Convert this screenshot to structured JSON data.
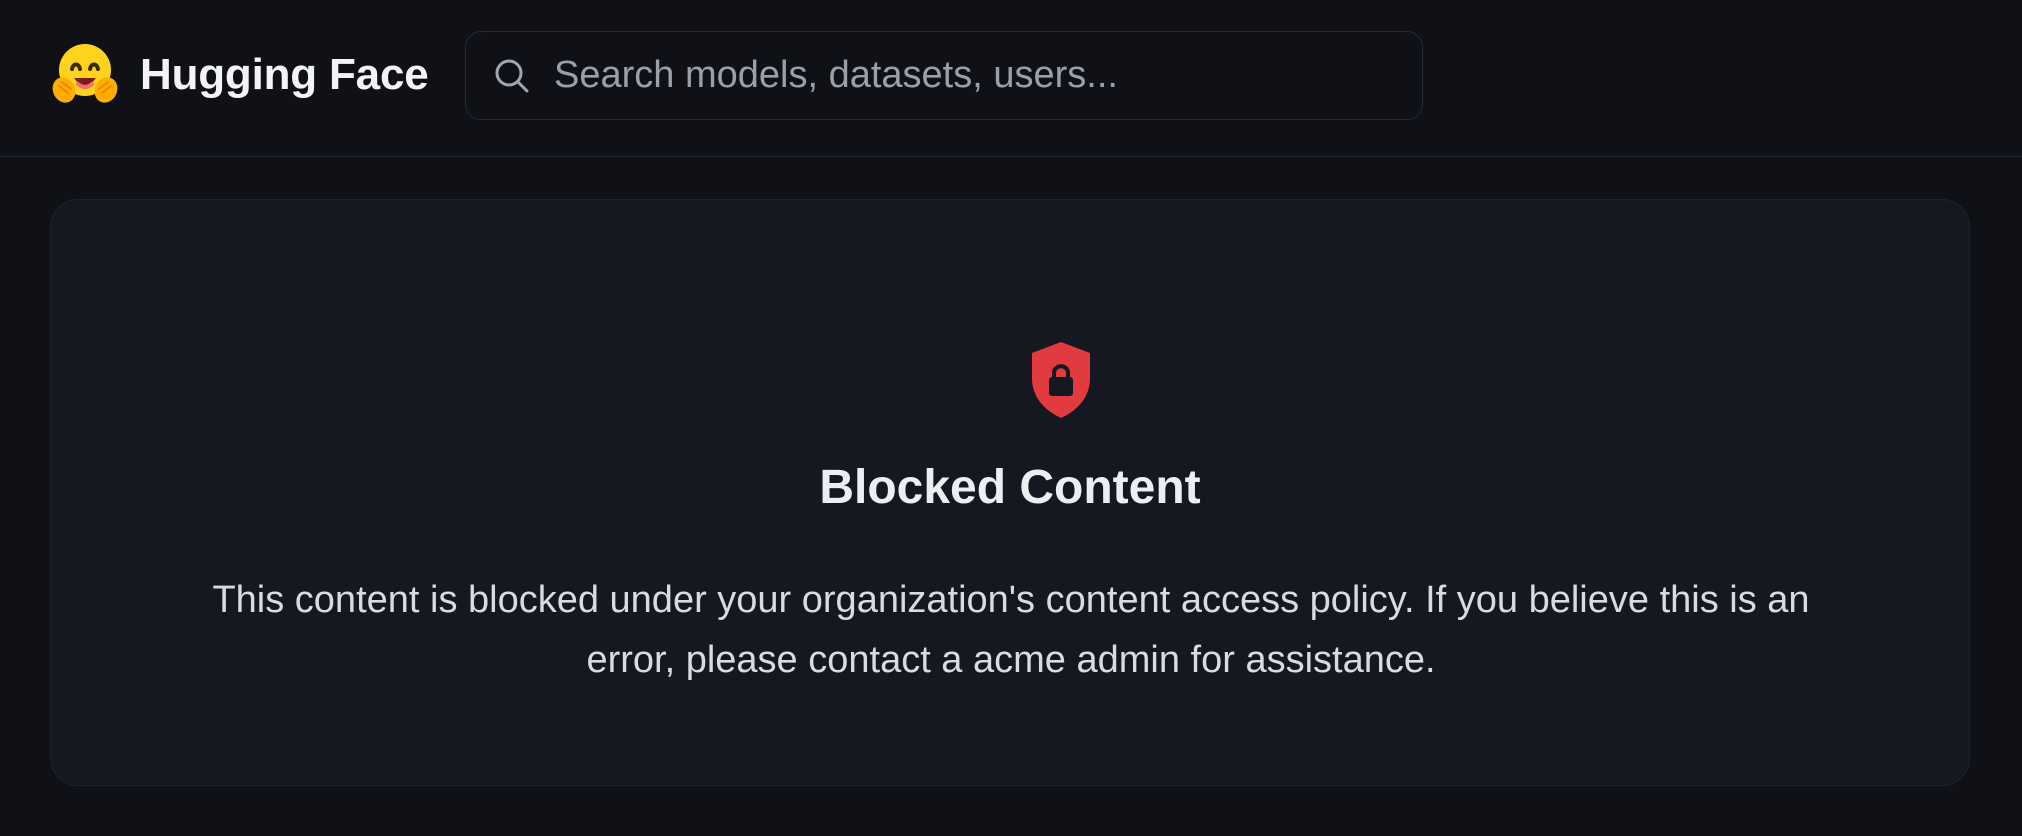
{
  "header": {
    "logo_text": "Hugging Face",
    "logo_icon": "hugging-face-emoji",
    "search": {
      "placeholder": "Search models, datasets, users...",
      "value": "",
      "icon": "search-icon"
    }
  },
  "blocked_card": {
    "icon": "shield-lock-icon",
    "title": "Blocked Content",
    "message": "This content is blocked under your organization's content access policy. If you believe this is an error, please contact a acme admin for assistance."
  },
  "colors": {
    "background": "#0f1117",
    "card_background": "#151821",
    "shield_red": "#e23b3f",
    "emoji_yellow": "#ffd21e"
  }
}
